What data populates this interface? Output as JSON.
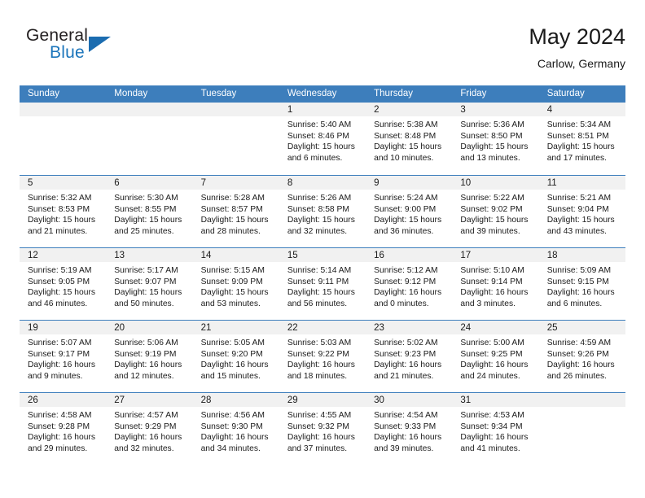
{
  "brand": {
    "word_one": "General",
    "word_two": "Blue",
    "triangle_icon": "brand-triangle-icon",
    "triangle_color": "#1b6cb0",
    "blue_color": "#1b75bb"
  },
  "header": {
    "title": "May 2024",
    "subtitle": "Carlow, Germany"
  },
  "theme": {
    "header_blue": "#3d7ebc",
    "daynum_band": "#f1f1f1",
    "text": "#1a1a1a"
  },
  "calendar": {
    "weekdays": [
      "Sunday",
      "Monday",
      "Tuesday",
      "Wednesday",
      "Thursday",
      "Friday",
      "Saturday"
    ],
    "weeks": [
      [
        {
          "day": "",
          "sunrise": "",
          "sunset": "",
          "daylight": "",
          "empty": true
        },
        {
          "day": "",
          "sunrise": "",
          "sunset": "",
          "daylight": "",
          "empty": true
        },
        {
          "day": "",
          "sunrise": "",
          "sunset": "",
          "daylight": "",
          "empty": true
        },
        {
          "day": "1",
          "sunrise": "Sunrise: 5:40 AM",
          "sunset": "Sunset: 8:46 PM",
          "daylight": "Daylight: 15 hours and 6 minutes."
        },
        {
          "day": "2",
          "sunrise": "Sunrise: 5:38 AM",
          "sunset": "Sunset: 8:48 PM",
          "daylight": "Daylight: 15 hours and 10 minutes."
        },
        {
          "day": "3",
          "sunrise": "Sunrise: 5:36 AM",
          "sunset": "Sunset: 8:50 PM",
          "daylight": "Daylight: 15 hours and 13 minutes."
        },
        {
          "day": "4",
          "sunrise": "Sunrise: 5:34 AM",
          "sunset": "Sunset: 8:51 PM",
          "daylight": "Daylight: 15 hours and 17 minutes."
        }
      ],
      [
        {
          "day": "5",
          "sunrise": "Sunrise: 5:32 AM",
          "sunset": "Sunset: 8:53 PM",
          "daylight": "Daylight: 15 hours and 21 minutes."
        },
        {
          "day": "6",
          "sunrise": "Sunrise: 5:30 AM",
          "sunset": "Sunset: 8:55 PM",
          "daylight": "Daylight: 15 hours and 25 minutes."
        },
        {
          "day": "7",
          "sunrise": "Sunrise: 5:28 AM",
          "sunset": "Sunset: 8:57 PM",
          "daylight": "Daylight: 15 hours and 28 minutes."
        },
        {
          "day": "8",
          "sunrise": "Sunrise: 5:26 AM",
          "sunset": "Sunset: 8:58 PM",
          "daylight": "Daylight: 15 hours and 32 minutes."
        },
        {
          "day": "9",
          "sunrise": "Sunrise: 5:24 AM",
          "sunset": "Sunset: 9:00 PM",
          "daylight": "Daylight: 15 hours and 36 minutes."
        },
        {
          "day": "10",
          "sunrise": "Sunrise: 5:22 AM",
          "sunset": "Sunset: 9:02 PM",
          "daylight": "Daylight: 15 hours and 39 minutes."
        },
        {
          "day": "11",
          "sunrise": "Sunrise: 5:21 AM",
          "sunset": "Sunset: 9:04 PM",
          "daylight": "Daylight: 15 hours and 43 minutes."
        }
      ],
      [
        {
          "day": "12",
          "sunrise": "Sunrise: 5:19 AM",
          "sunset": "Sunset: 9:05 PM",
          "daylight": "Daylight: 15 hours and 46 minutes."
        },
        {
          "day": "13",
          "sunrise": "Sunrise: 5:17 AM",
          "sunset": "Sunset: 9:07 PM",
          "daylight": "Daylight: 15 hours and 50 minutes."
        },
        {
          "day": "14",
          "sunrise": "Sunrise: 5:15 AM",
          "sunset": "Sunset: 9:09 PM",
          "daylight": "Daylight: 15 hours and 53 minutes."
        },
        {
          "day": "15",
          "sunrise": "Sunrise: 5:14 AM",
          "sunset": "Sunset: 9:11 PM",
          "daylight": "Daylight: 15 hours and 56 minutes."
        },
        {
          "day": "16",
          "sunrise": "Sunrise: 5:12 AM",
          "sunset": "Sunset: 9:12 PM",
          "daylight": "Daylight: 16 hours and 0 minutes."
        },
        {
          "day": "17",
          "sunrise": "Sunrise: 5:10 AM",
          "sunset": "Sunset: 9:14 PM",
          "daylight": "Daylight: 16 hours and 3 minutes."
        },
        {
          "day": "18",
          "sunrise": "Sunrise: 5:09 AM",
          "sunset": "Sunset: 9:15 PM",
          "daylight": "Daylight: 16 hours and 6 minutes."
        }
      ],
      [
        {
          "day": "19",
          "sunrise": "Sunrise: 5:07 AM",
          "sunset": "Sunset: 9:17 PM",
          "daylight": "Daylight: 16 hours and 9 minutes."
        },
        {
          "day": "20",
          "sunrise": "Sunrise: 5:06 AM",
          "sunset": "Sunset: 9:19 PM",
          "daylight": "Daylight: 16 hours and 12 minutes."
        },
        {
          "day": "21",
          "sunrise": "Sunrise: 5:05 AM",
          "sunset": "Sunset: 9:20 PM",
          "daylight": "Daylight: 16 hours and 15 minutes."
        },
        {
          "day": "22",
          "sunrise": "Sunrise: 5:03 AM",
          "sunset": "Sunset: 9:22 PM",
          "daylight": "Daylight: 16 hours and 18 minutes."
        },
        {
          "day": "23",
          "sunrise": "Sunrise: 5:02 AM",
          "sunset": "Sunset: 9:23 PM",
          "daylight": "Daylight: 16 hours and 21 minutes."
        },
        {
          "day": "24",
          "sunrise": "Sunrise: 5:00 AM",
          "sunset": "Sunset: 9:25 PM",
          "daylight": "Daylight: 16 hours and 24 minutes."
        },
        {
          "day": "25",
          "sunrise": "Sunrise: 4:59 AM",
          "sunset": "Sunset: 9:26 PM",
          "daylight": "Daylight: 16 hours and 26 minutes."
        }
      ],
      [
        {
          "day": "26",
          "sunrise": "Sunrise: 4:58 AM",
          "sunset": "Sunset: 9:28 PM",
          "daylight": "Daylight: 16 hours and 29 minutes."
        },
        {
          "day": "27",
          "sunrise": "Sunrise: 4:57 AM",
          "sunset": "Sunset: 9:29 PM",
          "daylight": "Daylight: 16 hours and 32 minutes."
        },
        {
          "day": "28",
          "sunrise": "Sunrise: 4:56 AM",
          "sunset": "Sunset: 9:30 PM",
          "daylight": "Daylight: 16 hours and 34 minutes."
        },
        {
          "day": "29",
          "sunrise": "Sunrise: 4:55 AM",
          "sunset": "Sunset: 9:32 PM",
          "daylight": "Daylight: 16 hours and 37 minutes."
        },
        {
          "day": "30",
          "sunrise": "Sunrise: 4:54 AM",
          "sunset": "Sunset: 9:33 PM",
          "daylight": "Daylight: 16 hours and 39 minutes."
        },
        {
          "day": "31",
          "sunrise": "Sunrise: 4:53 AM",
          "sunset": "Sunset: 9:34 PM",
          "daylight": "Daylight: 16 hours and 41 minutes."
        },
        {
          "day": "",
          "sunrise": "",
          "sunset": "",
          "daylight": "",
          "empty": true
        }
      ]
    ]
  }
}
